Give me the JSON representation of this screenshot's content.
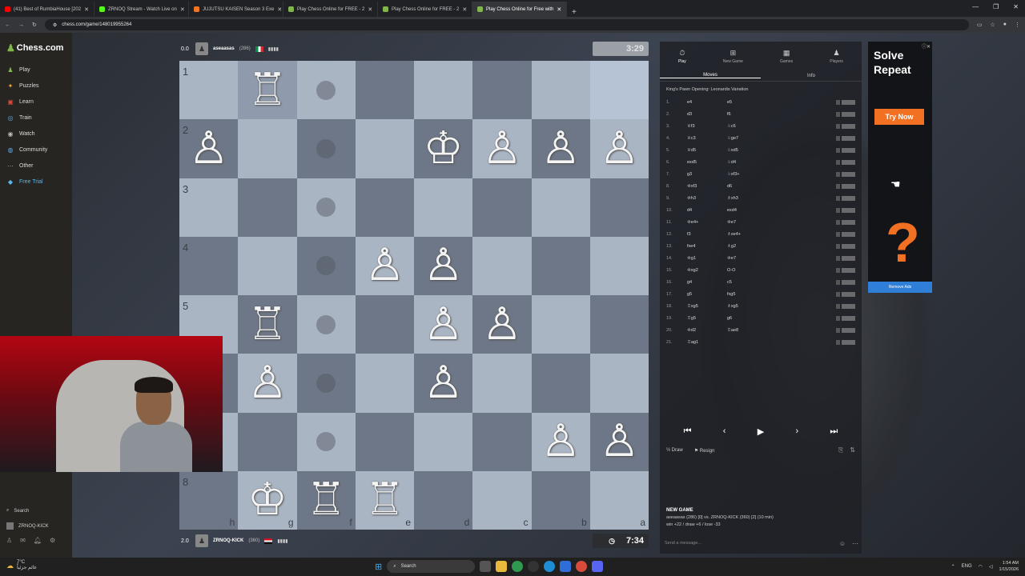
{
  "browser": {
    "tabs": [
      {
        "title": "(41) Best of RumbiaHouse [202",
        "color": "#ff0000",
        "active": false
      },
      {
        "title": "ZRNOQ Stream - Watch Live on",
        "color": "#53fc18",
        "active": false
      },
      {
        "title": "JUJUTSU KAISEN Season 3 Exe",
        "color": "#f47521",
        "active": false
      },
      {
        "title": "Play Chess Online for FREE - 2",
        "color": "#81b64c",
        "active": false
      },
      {
        "title": "Play Chess Online for FREE - 2",
        "color": "#81b64c",
        "active": false
      },
      {
        "title": "Play Chess Online for Free with",
        "color": "#81b64c",
        "active": true
      }
    ],
    "url": "chess.com/game/148019955264"
  },
  "sidebar": {
    "logo": "Chess.com",
    "items": [
      {
        "label": "Play",
        "icon": "play-icon"
      },
      {
        "label": "Puzzles",
        "icon": "puzzle-icon"
      },
      {
        "label": "Learn",
        "icon": "learn-icon"
      },
      {
        "label": "Train",
        "icon": "train-icon"
      },
      {
        "label": "Watch",
        "icon": "watch-icon"
      },
      {
        "label": "Community",
        "icon": "community-icon"
      },
      {
        "label": "Other",
        "icon": "more-icon"
      },
      {
        "label": "Free Trial",
        "icon": "diamond-icon"
      }
    ],
    "search_label": "Search",
    "username": "ZRNOQ-KICK"
  },
  "top_player": {
    "score": "0.0",
    "name": "aseaasas",
    "rating": "(286)",
    "clock": "3:29"
  },
  "bottom_player": {
    "score": "2.0",
    "name": "ZRNOQ-KICK",
    "rating": "(360)",
    "clock": "7:34"
  },
  "board": {
    "ranks": [
      "1",
      "2",
      "3",
      "4",
      "5",
      "6",
      "7",
      "8"
    ],
    "files": [
      "h",
      "g",
      "f",
      "e",
      "d",
      "c",
      "b",
      "a"
    ],
    "pieces": [
      {
        "pos": "g1",
        "type": "rook",
        "color": "white"
      },
      {
        "pos": "h2",
        "type": "pawn",
        "color": "white"
      },
      {
        "pos": "d2",
        "type": "king",
        "color": "white"
      },
      {
        "pos": "c2",
        "type": "pawn",
        "color": "white"
      },
      {
        "pos": "b2",
        "type": "pawn",
        "color": "white"
      },
      {
        "pos": "a2",
        "type": "pawn",
        "color": "white"
      },
      {
        "pos": "e4",
        "type": "pawn",
        "color": "white"
      },
      {
        "pos": "d4",
        "type": "pawn",
        "color": "white"
      },
      {
        "pos": "g5",
        "type": "rook",
        "color": "white"
      },
      {
        "pos": "d5",
        "type": "pawn",
        "color": "white"
      },
      {
        "pos": "c5",
        "type": "pawn",
        "color": "white"
      },
      {
        "pos": "g6",
        "type": "pawn",
        "color": "white"
      },
      {
        "pos": "d6",
        "type": "pawn",
        "color": "white"
      },
      {
        "pos": "b7",
        "type": "pawn",
        "color": "white"
      },
      {
        "pos": "a7",
        "type": "pawn",
        "color": "white"
      },
      {
        "pos": "g8",
        "type": "king",
        "color": "white"
      },
      {
        "pos": "f8",
        "type": "rook",
        "color": "white"
      },
      {
        "pos": "e8",
        "type": "rook",
        "color": "white"
      }
    ],
    "move_dots": [
      "f1",
      "f2",
      "f3",
      "f4",
      "f5",
      "f6",
      "f7"
    ],
    "highlights": [
      "g1",
      "a1"
    ]
  },
  "panel": {
    "tabs": [
      {
        "label": "Play",
        "icon": "stopwatch-icon"
      },
      {
        "label": "New Game",
        "icon": "plus-icon"
      },
      {
        "label": "Games",
        "icon": "games-icon"
      },
      {
        "label": "Players",
        "icon": "players-icon"
      }
    ],
    "subtabs": [
      "Moves",
      "Info"
    ],
    "opening": "King's Pawn Opening: Leonardis Variation",
    "moves": [
      {
        "n": "1.",
        "w": "e4",
        "b": "e5"
      },
      {
        "n": "2.",
        "w": "d3",
        "b": "f6"
      },
      {
        "n": "3.",
        "w": "♕f3",
        "b": "♘c6"
      },
      {
        "n": "4.",
        "w": "♕c3",
        "b": "♘ge7"
      },
      {
        "n": "5.",
        "w": "♕d5",
        "b": "♘xd5"
      },
      {
        "n": "6.",
        "w": "exd5",
        "b": "♘d4"
      },
      {
        "n": "7.",
        "w": "g3",
        "b": "♘xf3+"
      },
      {
        "n": "8.",
        "w": "♔xf3",
        "b": "d6"
      },
      {
        "n": "9.",
        "w": "♔h3",
        "b": "♗xh3"
      },
      {
        "n": "10.",
        "w": "d4",
        "b": "exd4"
      },
      {
        "n": "11.",
        "w": "♔e4+",
        "b": "♔e7"
      },
      {
        "n": "12.",
        "w": "f3",
        "b": "♗xe4+"
      },
      {
        "n": "13.",
        "w": "fxe4",
        "b": "♗g2"
      },
      {
        "n": "14.",
        "w": "♔g1",
        "b": "♔e7"
      },
      {
        "n": "15.",
        "w": "♔xg2",
        "b": "O-O"
      },
      {
        "n": "16.",
        "w": "g4",
        "b": "c5"
      },
      {
        "n": "17.",
        "w": "g5",
        "b": "fxg5"
      },
      {
        "n": "18.",
        "w": "♖xg5",
        "b": "♗xg5"
      },
      {
        "n": "19.",
        "w": "♖g5",
        "b": "g6"
      },
      {
        "n": "20.",
        "w": "♔d2",
        "b": "♖ae8"
      },
      {
        "n": "21.",
        "w": "♖ag1",
        "b": ""
      }
    ],
    "actions": {
      "draw": "Draw",
      "resign": "Resign"
    },
    "new_game": {
      "title": "NEW GAME",
      "line1": "aseaasas (286) [0] vs. ZRNOQ-KICK (360) [2] (10 min)",
      "line2": "win +22 / draw +6 / lose -33"
    },
    "chat_placeholder": "Send a message..."
  },
  "ad": {
    "title": "Solve Repeat",
    "button": "Try Now",
    "remove": "Remove Ads",
    "accent": "#f27022"
  },
  "taskbar": {
    "temp": "7°C",
    "weather": "غائم جزئياً",
    "search": "Search",
    "lang": "ENG",
    "time": "1:54 AM",
    "date": "1/15/2026"
  }
}
